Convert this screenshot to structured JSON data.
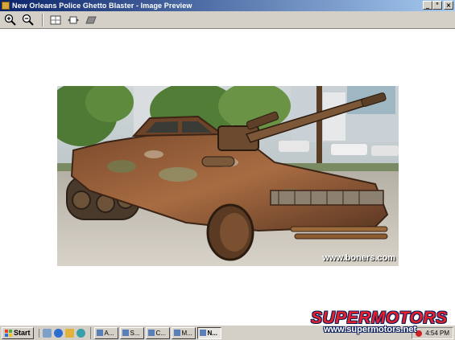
{
  "window": {
    "title": "New Orleans Police Ghetto Blaster - Image Preview",
    "controls": [
      "_",
      "°",
      "×"
    ]
  },
  "toolbar": {
    "buttons": [
      {
        "icon": "zoom-in-icon"
      },
      {
        "icon": "zoom-out-icon"
      },
      {
        "icon": "best-fit-icon"
      },
      {
        "icon": "actual-size-icon"
      },
      {
        "icon": "slideshow-icon"
      }
    ]
  },
  "image": {
    "subject": "rusted armored car with mounted cannon",
    "watermark": "www.boners.com"
  },
  "taskbar": {
    "start_label": "Start",
    "tasks": [
      "A...",
      "S...",
      "C...",
      "M...",
      "N..."
    ],
    "clock": "4:54 PM"
  },
  "overlay": {
    "brand": "SUPERMOTORS",
    "url": "www.supermotors.net"
  },
  "colors": {
    "titlebar_start": "#0a246a",
    "titlebar_end": "#a6caf0",
    "chrome": "#d4d0c8",
    "brand_red": "#e8202a",
    "brand_navy": "#0c1e5c"
  }
}
